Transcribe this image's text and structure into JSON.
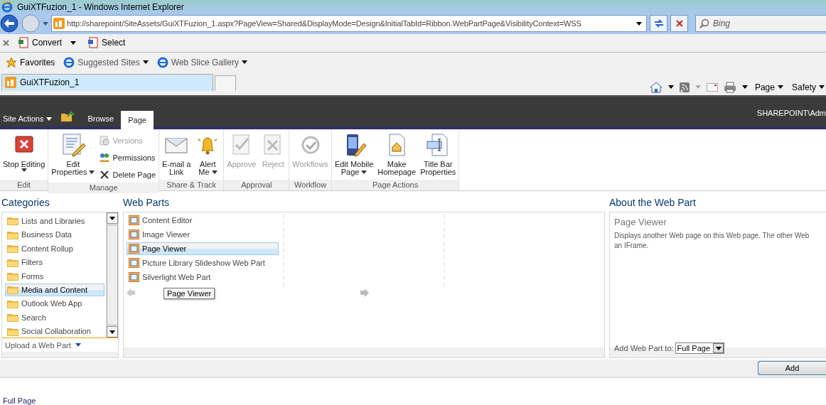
{
  "window": {
    "title": "GuiXTFuzion_1 - Windows Internet Explorer"
  },
  "address_bar": {
    "url": "http://sharepoint/SiteAssets/GuiXTFuzion_1.aspx?PageView=Shared&DisplayMode=Design&InitialTabId=Ribbon.WebPartPage&VisibilityContext=WSS"
  },
  "search": {
    "placeholder": "Bing"
  },
  "command_bar": [
    {
      "label": "Convert",
      "dropdown": true
    },
    {
      "label": "Select",
      "dropdown": false
    }
  ],
  "favorites_bar": [
    {
      "label": "Favorites",
      "dropdown": false
    },
    {
      "label": "Suggested Sites",
      "dropdown": true
    },
    {
      "label": "Web Slice Gallery",
      "dropdown": true
    }
  ],
  "browser_tabs": [
    {
      "label": "GuiXTFuzion_1",
      "selected": true
    }
  ],
  "browser_tools": [
    {
      "label": "Page"
    },
    {
      "label": "Safety"
    }
  ],
  "site_bar": {
    "site_actions": "Site Actions",
    "user": "SHAREPOINT\\Adm",
    "tabs": [
      {
        "label": "Browse",
        "selected": false
      },
      {
        "label": "Page",
        "selected": true
      }
    ]
  },
  "ribbon": [
    {
      "group": "Edit",
      "commands": [
        {
          "kind": "large",
          "lines": [
            "Stop Editing"
          ],
          "dropdown": true,
          "disabled": false
        }
      ]
    },
    {
      "group": "Manage",
      "commands": [
        {
          "kind": "large",
          "lines": [
            "Edit",
            "Properties"
          ],
          "dropdown": true,
          "disabled": false
        },
        {
          "kind": "small",
          "lines": [
            "Versions"
          ],
          "dropdown": false,
          "disabled": true
        },
        {
          "kind": "small",
          "lines": [
            "Permissions"
          ],
          "dropdown": false,
          "disabled": false
        },
        {
          "kind": "small",
          "lines": [
            "Delete Page"
          ],
          "dropdown": false,
          "disabled": false
        }
      ]
    },
    {
      "group": "Share & Track",
      "commands": [
        {
          "kind": "large",
          "lines": [
            "E-mail a",
            "Link"
          ],
          "dropdown": false,
          "disabled": false
        },
        {
          "kind": "large",
          "lines": [
            "Alert",
            "Me"
          ],
          "dropdown": true,
          "disabled": false
        }
      ]
    },
    {
      "group": "Approval",
      "commands": [
        {
          "kind": "large",
          "lines": [
            "Approve"
          ],
          "dropdown": false,
          "disabled": true
        },
        {
          "kind": "large",
          "lines": [
            "Reject"
          ],
          "dropdown": false,
          "disabled": true
        }
      ]
    },
    {
      "group": "Workflow",
      "commands": [
        {
          "kind": "large",
          "lines": [
            "Workflows"
          ],
          "dropdown": false,
          "disabled": true
        }
      ]
    },
    {
      "group": "Page Actions",
      "commands": [
        {
          "kind": "large",
          "lines": [
            "Edit Mobile",
            "Page"
          ],
          "dropdown": true,
          "disabled": false
        },
        {
          "kind": "large",
          "lines": [
            "Make",
            "Homepage"
          ],
          "dropdown": false,
          "disabled": false
        },
        {
          "kind": "large",
          "lines": [
            "Title Bar",
            "Properties"
          ],
          "dropdown": false,
          "disabled": false
        }
      ]
    }
  ],
  "categories": {
    "title": "Categories",
    "items": [
      {
        "label": "Lists and Libraries",
        "selected": false
      },
      {
        "label": "Business Data",
        "selected": false
      },
      {
        "label": "Content Rollup",
        "selected": false
      },
      {
        "label": "Filters",
        "selected": false
      },
      {
        "label": "Forms",
        "selected": false
      },
      {
        "label": "Media and Content",
        "selected": true
      },
      {
        "label": "Outlook Web App",
        "selected": false
      },
      {
        "label": "Search",
        "selected": false
      },
      {
        "label": "Social Collaboration",
        "selected": false
      }
    ],
    "upload": "Upload a Web Part"
  },
  "web_parts": {
    "title": "Web Parts",
    "items": [
      {
        "label": "Content Editor",
        "selected": false
      },
      {
        "label": "Image Viewer",
        "selected": false
      },
      {
        "label": "Page Viewer",
        "selected": true
      },
      {
        "label": "Picture Library Slideshow Web Part",
        "selected": false
      },
      {
        "label": "Silverlight Web Part",
        "selected": false
      }
    ],
    "tooltip": "Page Viewer"
  },
  "about": {
    "title": "About the Web Part",
    "name": "Page Viewer",
    "description": [
      "Displays another Web page on this Web page. The other Web",
      "an IFrame."
    ],
    "add_to_label": "Add Web Part to:",
    "add_to_value": "Full Page"
  },
  "add_button": "Add",
  "footer": "Full Page"
}
